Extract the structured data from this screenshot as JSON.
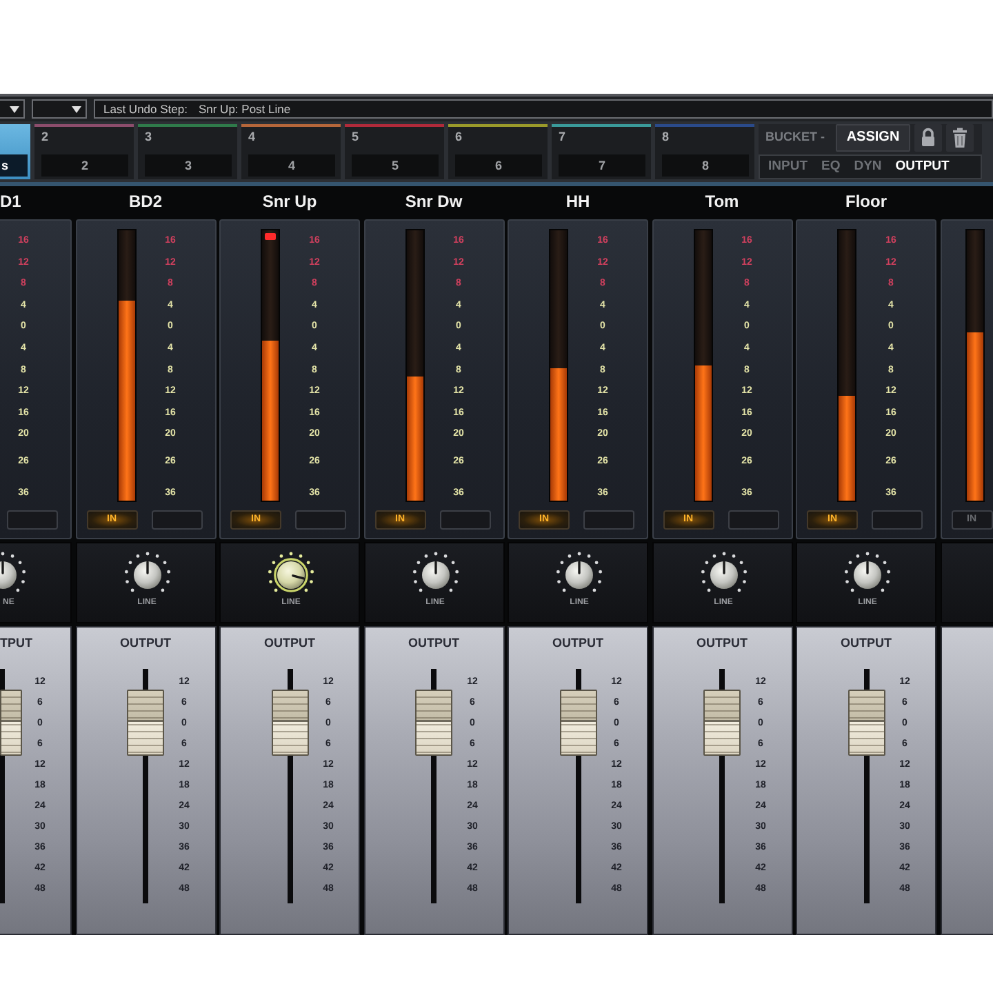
{
  "toolbar": {
    "undo_label": "Last Undo Step:",
    "undo_value": "Snr Up: Post Line"
  },
  "banks": [
    {
      "name": "s",
      "selected": true
    },
    {
      "number": "2",
      "name": "2",
      "color": "#8c4d6c",
      "selected": false
    },
    {
      "number": "3",
      "name": "3",
      "color": "#2f7a4a",
      "selected": false
    },
    {
      "number": "4",
      "name": "4",
      "color": "#b5663a",
      "selected": false
    },
    {
      "number": "5",
      "name": "5",
      "color": "#b02a3a",
      "selected": false
    },
    {
      "number": "6",
      "name": "6",
      "color": "#9a9a2a",
      "selected": false
    },
    {
      "number": "7",
      "name": "7",
      "color": "#3a9a9a",
      "selected": false
    },
    {
      "number": "8",
      "name": "8",
      "color": "#2a4a8a",
      "selected": false
    }
  ],
  "bucket": {
    "label": "BUCKET -",
    "assign": "ASSIGN"
  },
  "views": [
    {
      "label": "INPUT",
      "selected": false
    },
    {
      "label": "EQ",
      "selected": false
    },
    {
      "label": "DYN",
      "selected": false
    },
    {
      "label": "OUTPUT",
      "selected": true
    }
  ],
  "channels": [
    {
      "name": "D1",
      "meter_scale": [
        {
          "text": "16",
          "color": "#d0405e"
        },
        {
          "text": "12",
          "color": "#d0405e"
        },
        {
          "text": "8",
          "color": "#d0405e"
        },
        {
          "text": "4",
          "color": "#e4e4a8"
        },
        {
          "text": "0",
          "color": "#e4e4a8"
        },
        {
          "text": "4",
          "color": "#e4e4a8"
        },
        {
          "text": "8",
          "color": "#e4e4a8"
        },
        {
          "text": "12",
          "color": "#e4e4a8"
        },
        {
          "text": "16",
          "color": "#e4e4a8"
        },
        {
          "text": "20",
          "color": "#e4e4a8"
        },
        {
          "text": "26",
          "color": "#e4e4a8"
        },
        {
          "text": "36",
          "color": "#e4e4a8"
        }
      ],
      "buttons": [
        {
          "lit": false
        }
      ],
      "knob": {
        "label": "NE",
        "turned": false,
        "active": false
      },
      "fader": {
        "label": "TPUT",
        "level": 0.77,
        "scale": [
          "12",
          "6",
          "0",
          "6",
          "12",
          "18",
          "24",
          "30",
          "36",
          "42",
          "48"
        ]
      }
    },
    {
      "name": "BD2",
      "meter": {
        "level": 0.74,
        "clip": false
      },
      "meter_scale": [
        {
          "text": "16",
          "color": "#d0405e"
        },
        {
          "text": "12",
          "color": "#d0405e"
        },
        {
          "text": "8",
          "color": "#d0405e"
        },
        {
          "text": "4",
          "color": "#e4e4a8"
        },
        {
          "text": "0",
          "color": "#e4e4a8"
        },
        {
          "text": "4",
          "color": "#e4e4a8"
        },
        {
          "text": "8",
          "color": "#e4e4a8"
        },
        {
          "text": "12",
          "color": "#e4e4a8"
        },
        {
          "text": "16",
          "color": "#e4e4a8"
        },
        {
          "text": "20",
          "color": "#e4e4a8"
        },
        {
          "text": "26",
          "color": "#e4e4a8"
        },
        {
          "text": "36",
          "color": "#e4e4a8"
        }
      ],
      "buttons": [
        {
          "label": "IN",
          "lit": true
        },
        {
          "lit": false
        }
      ],
      "knob": {
        "label": "LINE",
        "turned": false,
        "active": false
      },
      "fader": {
        "label": "OUTPUT",
        "level": 0.77,
        "scale": [
          "12",
          "6",
          "0",
          "6",
          "12",
          "18",
          "24",
          "30",
          "36",
          "42",
          "48"
        ]
      }
    },
    {
      "name": "Snr Up",
      "meter": {
        "level": 0.59,
        "clip": true
      },
      "meter_scale": [
        {
          "text": "16",
          "color": "#d0405e"
        },
        {
          "text": "12",
          "color": "#d0405e"
        },
        {
          "text": "8",
          "color": "#d0405e"
        },
        {
          "text": "4",
          "color": "#e4e4a8"
        },
        {
          "text": "0",
          "color": "#e4e4a8"
        },
        {
          "text": "4",
          "color": "#e4e4a8"
        },
        {
          "text": "8",
          "color": "#e4e4a8"
        },
        {
          "text": "12",
          "color": "#e4e4a8"
        },
        {
          "text": "16",
          "color": "#e4e4a8"
        },
        {
          "text": "20",
          "color": "#e4e4a8"
        },
        {
          "text": "26",
          "color": "#e4e4a8"
        },
        {
          "text": "36",
          "color": "#e4e4a8"
        }
      ],
      "buttons": [
        {
          "label": "IN",
          "lit": true
        },
        {
          "lit": false
        }
      ],
      "knob": {
        "label": "LINE",
        "turned": true,
        "active": true
      },
      "fader": {
        "label": "OUTPUT",
        "level": 0.77,
        "scale": [
          "12",
          "6",
          "0",
          "6",
          "12",
          "18",
          "24",
          "30",
          "36",
          "42",
          "48"
        ]
      }
    },
    {
      "name": "Snr Dw",
      "meter": {
        "level": 0.46,
        "clip": false
      },
      "meter_scale": [
        {
          "text": "16",
          "color": "#d0405e"
        },
        {
          "text": "12",
          "color": "#d0405e"
        },
        {
          "text": "8",
          "color": "#d0405e"
        },
        {
          "text": "4",
          "color": "#e4e4a8"
        },
        {
          "text": "0",
          "color": "#e4e4a8"
        },
        {
          "text": "4",
          "color": "#e4e4a8"
        },
        {
          "text": "8",
          "color": "#e4e4a8"
        },
        {
          "text": "12",
          "color": "#e4e4a8"
        },
        {
          "text": "16",
          "color": "#e4e4a8"
        },
        {
          "text": "20",
          "color": "#e4e4a8"
        },
        {
          "text": "26",
          "color": "#e4e4a8"
        },
        {
          "text": "36",
          "color": "#e4e4a8"
        }
      ],
      "buttons": [
        {
          "label": "IN",
          "lit": true
        },
        {
          "lit": false
        }
      ],
      "knob": {
        "label": "LINE",
        "turned": false,
        "active": false
      },
      "fader": {
        "label": "OUTPUT",
        "level": 0.77,
        "scale": [
          "12",
          "6",
          "0",
          "6",
          "12",
          "18",
          "24",
          "30",
          "36",
          "42",
          "48"
        ]
      }
    },
    {
      "name": "HH",
      "meter": {
        "level": 0.49,
        "clip": false
      },
      "meter_scale": [
        {
          "text": "16",
          "color": "#d0405e"
        },
        {
          "text": "12",
          "color": "#d0405e"
        },
        {
          "text": "8",
          "color": "#d0405e"
        },
        {
          "text": "4",
          "color": "#e4e4a8"
        },
        {
          "text": "0",
          "color": "#e4e4a8"
        },
        {
          "text": "4",
          "color": "#e4e4a8"
        },
        {
          "text": "8",
          "color": "#e4e4a8"
        },
        {
          "text": "12",
          "color": "#e4e4a8"
        },
        {
          "text": "16",
          "color": "#e4e4a8"
        },
        {
          "text": "20",
          "color": "#e4e4a8"
        },
        {
          "text": "26",
          "color": "#e4e4a8"
        },
        {
          "text": "36",
          "color": "#e4e4a8"
        }
      ],
      "buttons": [
        {
          "label": "IN",
          "lit": true
        },
        {
          "lit": false
        }
      ],
      "knob": {
        "label": "LINE",
        "turned": false,
        "active": false
      },
      "fader": {
        "label": "OUTPUT",
        "level": 0.77,
        "scale": [
          "12",
          "6",
          "0",
          "6",
          "12",
          "18",
          "24",
          "30",
          "36",
          "42",
          "48"
        ]
      }
    },
    {
      "name": "Tom",
      "meter": {
        "level": 0.5,
        "clip": false
      },
      "meter_scale": [
        {
          "text": "16",
          "color": "#d0405e"
        },
        {
          "text": "12",
          "color": "#d0405e"
        },
        {
          "text": "8",
          "color": "#d0405e"
        },
        {
          "text": "4",
          "color": "#e4e4a8"
        },
        {
          "text": "0",
          "color": "#e4e4a8"
        },
        {
          "text": "4",
          "color": "#e4e4a8"
        },
        {
          "text": "8",
          "color": "#e4e4a8"
        },
        {
          "text": "12",
          "color": "#e4e4a8"
        },
        {
          "text": "16",
          "color": "#e4e4a8"
        },
        {
          "text": "20",
          "color": "#e4e4a8"
        },
        {
          "text": "26",
          "color": "#e4e4a8"
        },
        {
          "text": "36",
          "color": "#e4e4a8"
        }
      ],
      "buttons": [
        {
          "label": "IN",
          "lit": true
        },
        {
          "lit": false
        }
      ],
      "knob": {
        "label": "LINE",
        "turned": false,
        "active": false
      },
      "fader": {
        "label": "OUTPUT",
        "level": 0.77,
        "scale": [
          "12",
          "6",
          "0",
          "6",
          "12",
          "18",
          "24",
          "30",
          "36",
          "42",
          "48"
        ]
      }
    },
    {
      "name": "Floor",
      "meter": {
        "level": 0.39,
        "clip": false
      },
      "meter_scale": [
        {
          "text": "16",
          "color": "#d0405e"
        },
        {
          "text": "12",
          "color": "#d0405e"
        },
        {
          "text": "8",
          "color": "#d0405e"
        },
        {
          "text": "4",
          "color": "#e4e4a8"
        },
        {
          "text": "0",
          "color": "#e4e4a8"
        },
        {
          "text": "4",
          "color": "#e4e4a8"
        },
        {
          "text": "8",
          "color": "#e4e4a8"
        },
        {
          "text": "12",
          "color": "#e4e4a8"
        },
        {
          "text": "16",
          "color": "#e4e4a8"
        },
        {
          "text": "20",
          "color": "#e4e4a8"
        },
        {
          "text": "26",
          "color": "#e4e4a8"
        },
        {
          "text": "36",
          "color": "#e4e4a8"
        }
      ],
      "buttons": [
        {
          "label": "IN",
          "lit": true
        },
        {
          "lit": false
        }
      ],
      "knob": {
        "label": "LINE",
        "turned": false,
        "active": false
      },
      "fader": {
        "label": "OUTPUT",
        "level": 0.77,
        "scale": [
          "12",
          "6",
          "0",
          "6",
          "12",
          "18",
          "24",
          "30",
          "36",
          "42",
          "48"
        ]
      }
    },
    {
      "meter": {
        "level": 0.62,
        "clip": false
      },
      "buttons": [
        {
          "label": "IN",
          "lit": false
        }
      ]
    }
  ]
}
